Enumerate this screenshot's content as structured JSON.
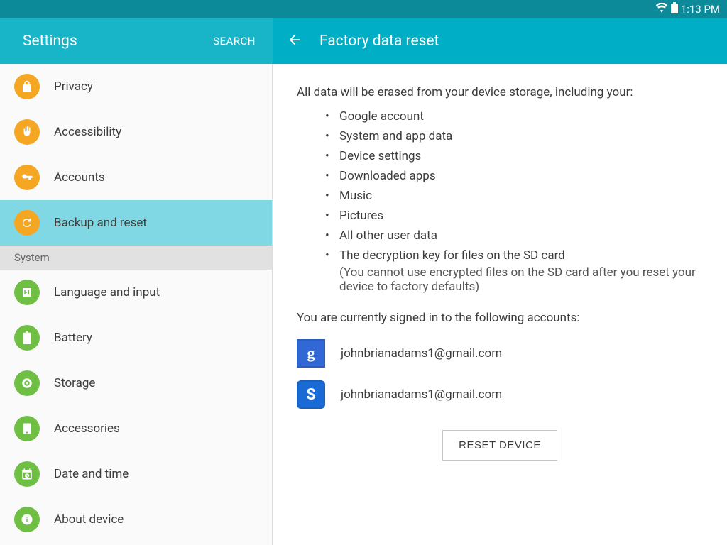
{
  "status": {
    "time": "1:13 PM"
  },
  "sidebar": {
    "title": "Settings",
    "search": "SEARCH",
    "items": [
      {
        "label": "Privacy",
        "icon": "lock",
        "color": "orange"
      },
      {
        "label": "Accessibility",
        "icon": "hand",
        "color": "orange"
      },
      {
        "label": "Accounts",
        "icon": "key",
        "color": "orange"
      },
      {
        "label": "Backup and reset",
        "icon": "backup",
        "color": "orange",
        "selected": true
      }
    ],
    "section_label": "System",
    "system_items": [
      {
        "label": "Language and input",
        "icon": "language",
        "color": "green"
      },
      {
        "label": "Battery",
        "icon": "battery",
        "color": "green"
      },
      {
        "label": "Storage",
        "icon": "storage",
        "color": "green"
      },
      {
        "label": "Accessories",
        "icon": "accessories",
        "color": "green"
      },
      {
        "label": "Date and time",
        "icon": "datetime",
        "color": "green"
      },
      {
        "label": "About device",
        "icon": "about",
        "color": "green"
      }
    ]
  },
  "detail": {
    "title": "Factory data reset",
    "intro": "All data will be erased from your device storage, including your:",
    "bullets": [
      "Google account",
      "System and app data",
      "Device settings",
      "Downloaded apps",
      "Music",
      "Pictures",
      "All other user data",
      "The decryption key for files on the SD card"
    ],
    "bullet_note": "(You cannot use encrypted files on the SD card after you reset your device to factory defaults)",
    "accounts_intro": "You are currently signed in to the following accounts:",
    "accounts": [
      {
        "badge": "g",
        "glyph": "g",
        "email": "johnbrianadams1@gmail.com"
      },
      {
        "badge": "s",
        "glyph": "S",
        "email": "johnbrianadams1@gmail.com"
      }
    ],
    "reset_button": "RESET DEVICE"
  }
}
